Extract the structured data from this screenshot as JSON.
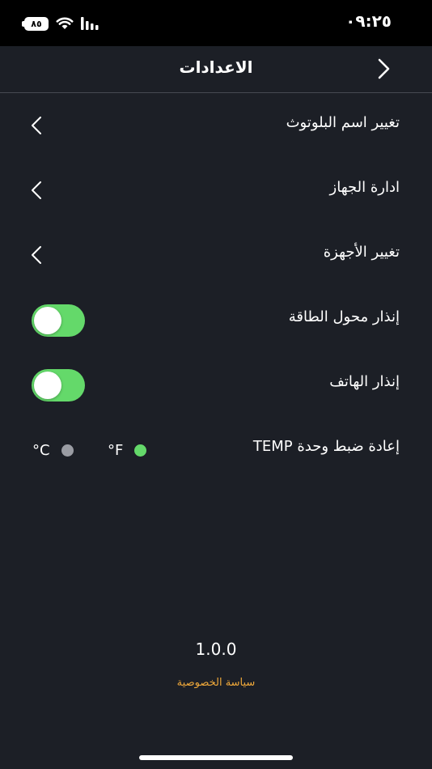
{
  "status_bar": {
    "time": "٠٩:٢٥",
    "battery_level": "٨٥"
  },
  "nav": {
    "title": "الاعدادات"
  },
  "settings": {
    "rename_bluetooth": "تغيير اسم البلوتوث",
    "device_management": "ادارة الجهاز",
    "change_devices": "تغيير الأجهزة",
    "power_converter_alarm": {
      "label": "إنذار محول الطاقة",
      "enabled": true
    },
    "phone_alarm": {
      "label": "إنذار الهاتف",
      "enabled": true
    },
    "temp_unit": {
      "label": "إعادة ضبط وحدة TEMP",
      "options": [
        {
          "label": "°F",
          "selected": true
        },
        {
          "label": "°C",
          "selected": false
        }
      ]
    }
  },
  "footer": {
    "version": "1.0.0",
    "privacy_policy": "سياسة الخصوصية"
  },
  "colors": {
    "background": "#1c1f26",
    "toggle_on": "#64d96a",
    "radio_selected": "#64d96a",
    "radio_unselected": "#9a9ca3",
    "link": "#f0a93a"
  }
}
